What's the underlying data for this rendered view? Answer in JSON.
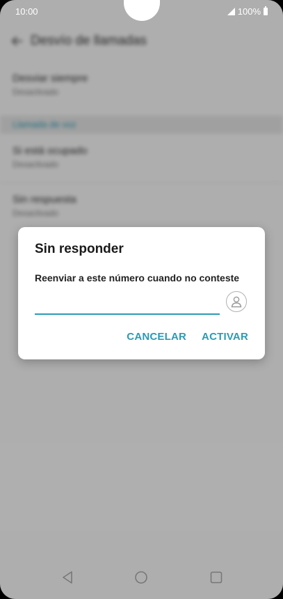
{
  "status_bar": {
    "time": "10:00",
    "battery": "100%"
  },
  "background_page": {
    "title": "Desvío de llamadas",
    "rows": [
      {
        "title": "Desviar siempre",
        "subtitle": "Desactivado"
      },
      {
        "title": "Si está ocupado",
        "subtitle": "Desactivado"
      },
      {
        "title": "Sin respuesta",
        "subtitle": "Desactivado"
      }
    ],
    "section_label": "Llamada de voz"
  },
  "dialog": {
    "title": "Sin responder",
    "message": "Reenviar a este número cuando no conteste",
    "input_value": "",
    "cancel_label": "CANCELAR",
    "activate_label": "ACTIVAR"
  },
  "icons": {
    "contact": "contact-picker-icon",
    "back": "nav-back-icon",
    "home": "nav-home-icon",
    "recents": "nav-recents-icon"
  },
  "colors": {
    "accent": "#2a9bb5"
  }
}
